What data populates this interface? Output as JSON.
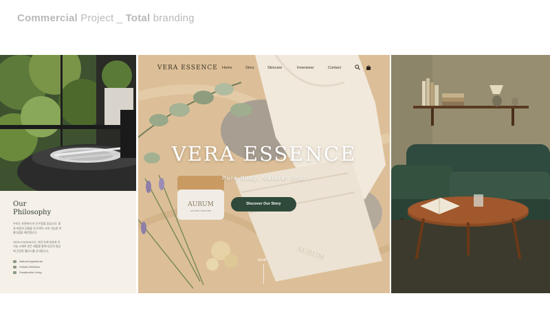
{
  "header": {
    "part1_bold": "Commercial",
    "part2": " Project _ ",
    "part3_bold": "Total",
    "part4": " branding"
  },
  "philosophy": {
    "title_line1": "Our",
    "title_line2": "Philosophy",
    "paragraph1": "우리는 자연에서 온 순수함을 믿습니다. 몸과 마음의 균형을 추구하며, 지속 가능한 아름다움을 제안합니다.",
    "paragraph2": "VERA ESSENCE는 자연 유래 성분과 유기농 소재로 만든 제품을 통해 당신의 일상에 건강한 웰니스를 선사합니다.",
    "values": [
      "Natural Ingredients",
      "Holistic Wellness",
      "Sustainable Living"
    ]
  },
  "hero": {
    "logo": "VERA ESSENCE",
    "nav": [
      "Home",
      "Story",
      "Skincare",
      "Innerwear",
      "Contact"
    ],
    "title": "VERA ESSENCE",
    "subtitle": "Pure Body, Natural Soul",
    "cta": "Discover Our Story",
    "scroll": "Scroll",
    "jar_label": "AURUM",
    "jar_sublabel": "NATURAL SKINCARE",
    "fabric_print": "AURUM"
  },
  "colors": {
    "accent_green": "#2f4a3a",
    "header_gray": "#b9b9b9",
    "philosophy_bg": "#f5f0e8",
    "sofa_green": "#2f4a3f"
  },
  "icons": [
    "search-icon",
    "bag-icon",
    "leaf-icon",
    "heart-icon",
    "recycle-icon"
  ]
}
